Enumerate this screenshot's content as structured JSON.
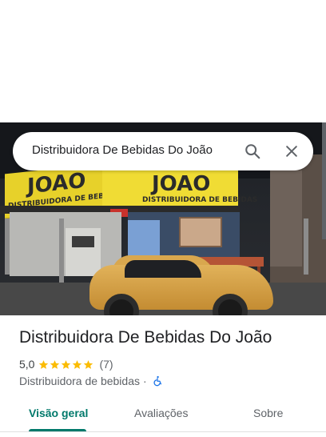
{
  "search": {
    "query": "Distribuidora De Bebidas Do João",
    "search_icon": "search-icon",
    "close_icon": "close-icon"
  },
  "hero_photo": {
    "sign_left_big": "JOAO",
    "sign_left_small": "DISTRIBUIDORA DE BEBIDAS",
    "sign_right_big": "JOAO",
    "sign_right_small": "DISTRIBUIDORA DE BEBIDAS"
  },
  "place": {
    "title": "Distribuidora De Bebidas Do João",
    "rating": "5,0",
    "stars": 5,
    "review_count": "(7)",
    "category": "Distribuidora de bebidas",
    "separator": "·",
    "accessibility_icon": "wheelchair-icon"
  },
  "tabs": {
    "overview": "Visão geral",
    "reviews": "Avaliações",
    "about": "Sobre"
  },
  "colors": {
    "accent": "#00796b",
    "star": "#fbbc04",
    "accessibility": "#1a73e8"
  }
}
